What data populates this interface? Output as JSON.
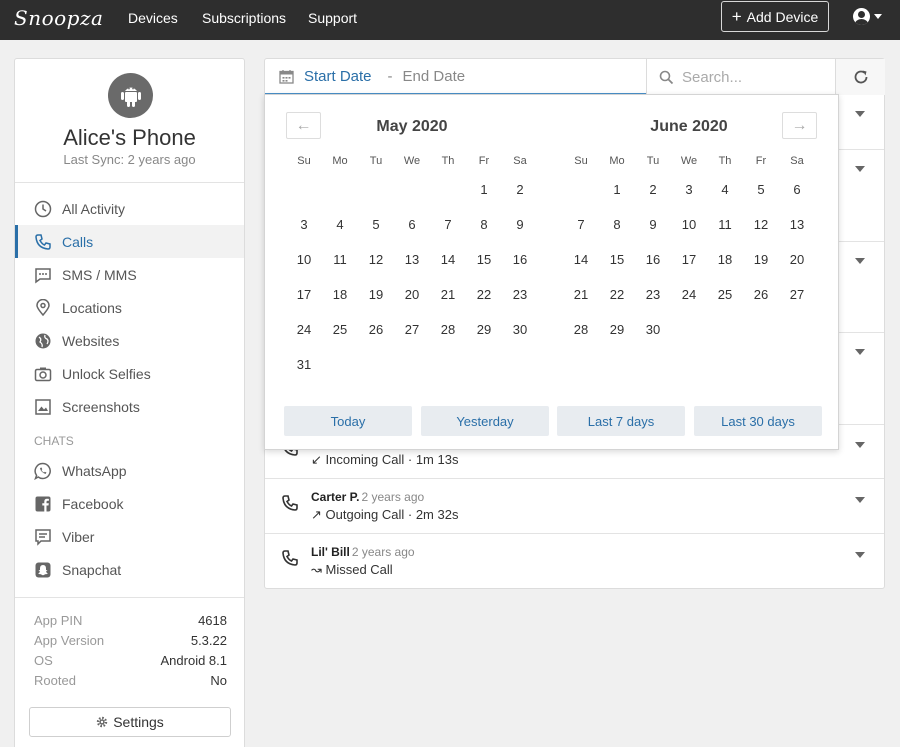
{
  "nav": {
    "logo": "Snoopza",
    "links": [
      "Devices",
      "Subscriptions",
      "Support"
    ],
    "add_device": "Add Device"
  },
  "device": {
    "name": "Alice's Phone",
    "last_sync": "Last Sync: 2 years ago"
  },
  "sidebar": {
    "items": [
      {
        "label": "All Activity",
        "icon": "clock-icon"
      },
      {
        "label": "Calls",
        "icon": "phone-icon"
      },
      {
        "label": "SMS / MMS",
        "icon": "sms-icon"
      },
      {
        "label": "Locations",
        "icon": "location-icon"
      },
      {
        "label": "Websites",
        "icon": "globe-icon"
      },
      {
        "label": "Unlock Selfies",
        "icon": "camera-icon"
      },
      {
        "label": "Screenshots",
        "icon": "image-icon"
      }
    ],
    "chats_header": "CHATS",
    "chats": [
      {
        "label": "WhatsApp",
        "icon": "whatsapp-icon"
      },
      {
        "label": "Facebook",
        "icon": "facebook-icon"
      },
      {
        "label": "Viber",
        "icon": "viber-icon"
      },
      {
        "label": "Snapchat",
        "icon": "snapchat-icon"
      }
    ],
    "info": [
      {
        "key": "App PIN",
        "value": "4618"
      },
      {
        "key": "App Version",
        "value": "5.3.22"
      },
      {
        "key": "OS",
        "value": "Android 8.1"
      },
      {
        "key": "Rooted",
        "value": "No"
      }
    ],
    "settings": "Settings"
  },
  "toolbar": {
    "start_date": "Start Date",
    "separator": "-",
    "end_date": "End Date",
    "search_placeholder": "Search..."
  },
  "calls": [
    {
      "name": "",
      "ago": "",
      "detail": "↙ Incoming Call · 1m 13s"
    },
    {
      "name": "Carter P.",
      "ago": "2 years ago",
      "detail": "↗ Outgoing Call · 2m 32s"
    },
    {
      "name": "Lil' Bill",
      "ago": "2 years ago",
      "detail": "↝ Missed Call"
    }
  ],
  "calendar": {
    "prev": "←",
    "next": "→",
    "weekdays": [
      "Su",
      "Mo",
      "Tu",
      "We",
      "Th",
      "Fr",
      "Sa"
    ],
    "months": [
      {
        "title": "May 2020",
        "first_weekday": 5,
        "days": 31
      },
      {
        "title": "June 2020",
        "first_weekday": 1,
        "days": 30
      }
    ],
    "presets": [
      "Today",
      "Yesterday",
      "Last 7 days",
      "Last 30 days"
    ]
  },
  "colors": {
    "accent": "#2a6fa8",
    "nav_bg": "#2e2e2e"
  }
}
